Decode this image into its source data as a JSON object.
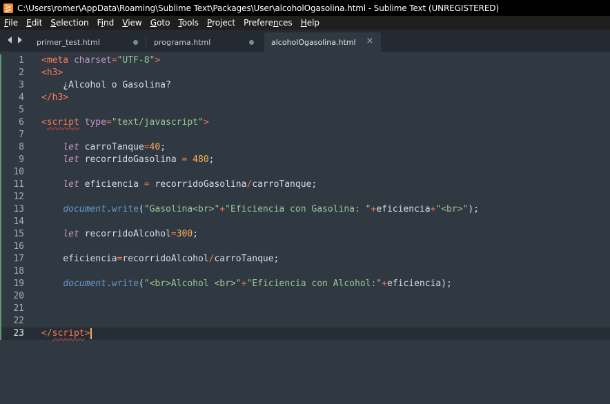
{
  "window": {
    "title": "C:\\Users\\romer\\AppData\\Roaming\\Sublime Text\\Packages\\User\\alcoholOgasolina.html - Sublime Text (UNREGISTERED)"
  },
  "menu": [
    {
      "u": "F",
      "rest": "ile"
    },
    {
      "u": "E",
      "rest": "dit"
    },
    {
      "u": "S",
      "rest": "election"
    },
    {
      "pre": "F",
      "u": "i",
      "rest": "nd"
    },
    {
      "u": "V",
      "rest": "iew"
    },
    {
      "u": "G",
      "rest": "oto"
    },
    {
      "u": "T",
      "rest": "ools"
    },
    {
      "u": "P",
      "rest": "roject"
    },
    {
      "pre": "Prefere",
      "u": "n",
      "rest": "ces"
    },
    {
      "u": "H",
      "rest": "elp"
    }
  ],
  "tabs": [
    {
      "label": "primer_test.html",
      "dirty": true,
      "active": false
    },
    {
      "label": "programa.html",
      "dirty": true,
      "active": false
    },
    {
      "label": "alcoholOgasolina.html",
      "dirty": false,
      "active": true
    }
  ],
  "tab_close_glyph": "×",
  "editor": {
    "current_line": 23,
    "line_numbers": [
      "1",
      "2",
      "3",
      "4",
      "5",
      "6",
      "7",
      "8",
      "9",
      "10",
      "11",
      "12",
      "13",
      "14",
      "15",
      "16",
      "17",
      "18",
      "19",
      "20",
      "21",
      "22",
      "23"
    ],
    "lines": [
      [
        [
          "tag",
          "<meta"
        ],
        [
          "txt",
          " "
        ],
        [
          "attr",
          "charset"
        ],
        [
          "op",
          "="
        ],
        [
          "str",
          "\"UTF-8\""
        ],
        [
          "tag",
          ">"
        ]
      ],
      [
        [
          "tag",
          "<h3>"
        ]
      ],
      [
        [
          "txt",
          "    ¿Alcohol o Gasolina?"
        ]
      ],
      [
        [
          "tag",
          "</h3>"
        ]
      ],
      [],
      [
        [
          "tag",
          "<"
        ],
        [
          "tag squig",
          "script"
        ],
        [
          "txt",
          " "
        ],
        [
          "attr",
          "type"
        ],
        [
          "op",
          "="
        ],
        [
          "str",
          "\"text/javascript\""
        ],
        [
          "tag",
          ">"
        ]
      ],
      [],
      [
        [
          "txt",
          "    "
        ],
        [
          "kw",
          "let"
        ],
        [
          "txt",
          " carroTanque"
        ],
        [
          "op",
          "="
        ],
        [
          "num",
          "40"
        ],
        [
          "txt",
          ";"
        ]
      ],
      [
        [
          "txt",
          "    "
        ],
        [
          "kw",
          "let"
        ],
        [
          "txt",
          " recorridoGasolina "
        ],
        [
          "op",
          "="
        ],
        [
          "txt",
          " "
        ],
        [
          "num",
          "480"
        ],
        [
          "txt",
          ";"
        ]
      ],
      [],
      [
        [
          "txt",
          "    "
        ],
        [
          "kw",
          "let"
        ],
        [
          "txt",
          " eficiencia "
        ],
        [
          "op",
          "="
        ],
        [
          "txt",
          " recorridoGasolina"
        ],
        [
          "op",
          "/"
        ],
        [
          "txt",
          "carroTanque;"
        ]
      ],
      [],
      [
        [
          "txt",
          "    "
        ],
        [
          "obj",
          "document"
        ],
        [
          "punc",
          "."
        ],
        [
          "fn",
          "write"
        ],
        [
          "txt",
          "("
        ],
        [
          "str",
          "\"Gasolina<br>\""
        ],
        [
          "op",
          "+"
        ],
        [
          "str",
          "\"Eficiencia con Gasolina: \""
        ],
        [
          "op",
          "+"
        ],
        [
          "txt",
          "eficiencia"
        ],
        [
          "op",
          "+"
        ],
        [
          "str",
          "\"<br>\""
        ],
        [
          "txt",
          ");"
        ]
      ],
      [],
      [
        [
          "txt",
          "    "
        ],
        [
          "kw",
          "let"
        ],
        [
          "txt",
          " recorridoAlcohol"
        ],
        [
          "op",
          "="
        ],
        [
          "num",
          "300"
        ],
        [
          "txt",
          ";"
        ]
      ],
      [],
      [
        [
          "txt",
          "    eficiencia"
        ],
        [
          "op",
          "="
        ],
        [
          "txt",
          "recorridoAlcohol"
        ],
        [
          "op",
          "/"
        ],
        [
          "txt",
          "carroTanque;"
        ]
      ],
      [],
      [
        [
          "txt",
          "    "
        ],
        [
          "obj",
          "document"
        ],
        [
          "punc",
          "."
        ],
        [
          "fn",
          "write"
        ],
        [
          "txt",
          "("
        ],
        [
          "str",
          "\"<br>Alcohol <br>\""
        ],
        [
          "op",
          "+"
        ],
        [
          "str",
          "\"Eficiencia con Alcohol:\""
        ],
        [
          "op",
          "+"
        ],
        [
          "txt",
          "eficiencia);"
        ]
      ],
      [],
      [],
      [],
      [
        [
          "tag",
          "</"
        ],
        [
          "tag squig",
          "script"
        ],
        [
          "tag",
          ">"
        ]
      ]
    ]
  },
  "colors": {
    "background": "#303841",
    "tag": "#f97b58",
    "attribute": "#c695c6",
    "string": "#99c794",
    "number": "#f9ae58",
    "function": "#6699cc",
    "text": "#d8dee9"
  }
}
